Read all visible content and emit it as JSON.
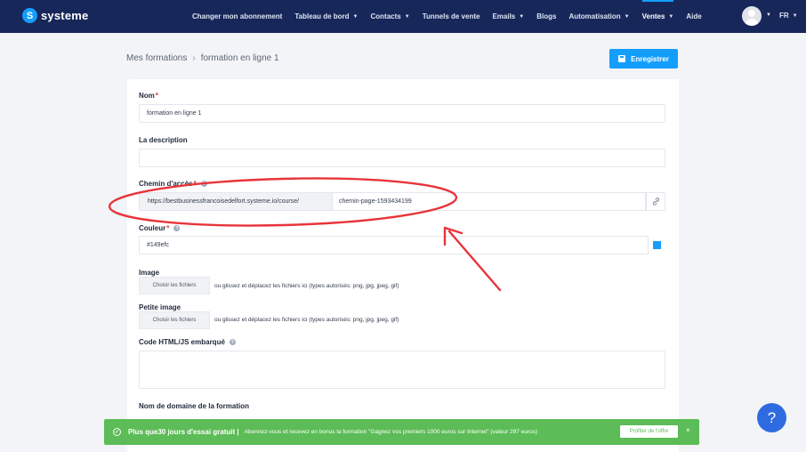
{
  "brand": {
    "name": "systeme"
  },
  "nav": {
    "items": [
      {
        "label": "Changer mon abonnement",
        "caret": false,
        "active": false
      },
      {
        "label": "Tableau de bord",
        "caret": true,
        "active": false
      },
      {
        "label": "Contacts",
        "caret": true,
        "active": false
      },
      {
        "label": "Tunnels de vente",
        "caret": false,
        "active": false
      },
      {
        "label": "Emails",
        "caret": true,
        "active": false
      },
      {
        "label": "Blogs",
        "caret": false,
        "active": false
      },
      {
        "label": "Automatisation",
        "caret": true,
        "active": false
      },
      {
        "label": "Ventes",
        "caret": true,
        "active": true
      },
      {
        "label": "Aide",
        "caret": false,
        "active": false
      }
    ],
    "language": "FR"
  },
  "breadcrumb": {
    "parent": "Mes formations",
    "current": "formation en ligne 1"
  },
  "toolbar": {
    "save_label": "Enregistrer"
  },
  "form": {
    "name": {
      "label": "Nom",
      "value": "formation en ligne 1"
    },
    "description": {
      "label": "La description",
      "value": ""
    },
    "path": {
      "label": "Chemin d'accès",
      "prefix": "https://bestbusinessfrancoisedelfort.systeme.io/course/",
      "value": "chemin-page-1593434199"
    },
    "color": {
      "label": "Couleur",
      "value": "#149efc"
    },
    "image": {
      "label": "Image",
      "button": "Choisir les fichiers",
      "hint": "ou glissez et déplacez les fichiers ici (types autorisés: png, jpg, jpeg, gif)"
    },
    "small_image": {
      "label": "Petite image",
      "button": "Choisir les fichiers",
      "hint": "ou glissez et déplacez les fichiers ici (types autorisés: png, jpg, jpeg, gif)"
    },
    "embed_code": {
      "label": "Code HTML/JS embarqué",
      "value": ""
    },
    "domain": {
      "label": "Nom de domaine de la formation"
    }
  },
  "promo": {
    "headline": "Plus que30 jours d'essai gratuit |",
    "text": "Abonnez-vous et recevez en bonus la formation \"Gagnez vos premiers 1000 euros sur Internet\" (valeur 297 euros)",
    "cta": "Profiter de l'offre",
    "close": "×"
  },
  "help": {
    "symbol": "?"
  },
  "colors": {
    "accent": "#149efc",
    "nav_bg": "#17275a",
    "promo_bg": "#5cbc57",
    "annotation": "#e8343a"
  }
}
